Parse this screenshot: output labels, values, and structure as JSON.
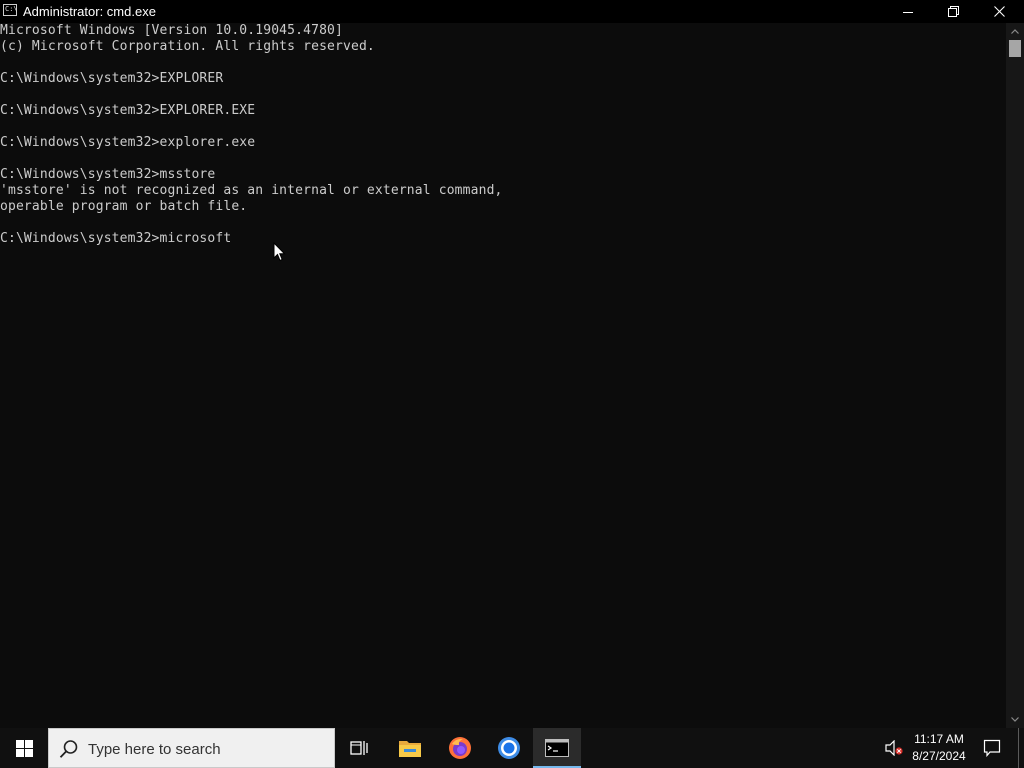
{
  "window": {
    "title": "Administrator: cmd.exe",
    "icon_text": "C:\\"
  },
  "console": {
    "lines": [
      "Microsoft Windows [Version 10.0.19045.4780]",
      "(c) Microsoft Corporation. All rights reserved.",
      "",
      "C:\\Windows\\system32>EXPLORER",
      "",
      "C:\\Windows\\system32>EXPLORER.EXE",
      "",
      "C:\\Windows\\system32>explorer.exe",
      "",
      "C:\\Windows\\system32>msstore",
      "'msstore' is not recognized as an internal or external command,",
      "operable program or batch file.",
      "",
      "C:\\Windows\\system32>microsoft"
    ]
  },
  "taskbar": {
    "search_placeholder": "Type here to search",
    "clock": {
      "time": "11:17 AM",
      "date": "8/27/2024"
    },
    "icons": {
      "start": "windows-logo-icon",
      "search": "search-icon",
      "task_view": "task-view-icon",
      "explorer": "file-explorer-icon",
      "firefox": "firefox-icon",
      "chrome": "chrome-icon",
      "cmd": "command-prompt-icon",
      "volume": "volume-muted-icon",
      "notifications": "action-center-icon"
    }
  },
  "colors": {
    "console_bg": "#0c0c0c",
    "console_text": "#cccccc",
    "titlebar_bg": "#000000",
    "taskbar_bg": "#101010",
    "search_bg": "#f0f0f0",
    "active_underline": "#76b9ed"
  }
}
